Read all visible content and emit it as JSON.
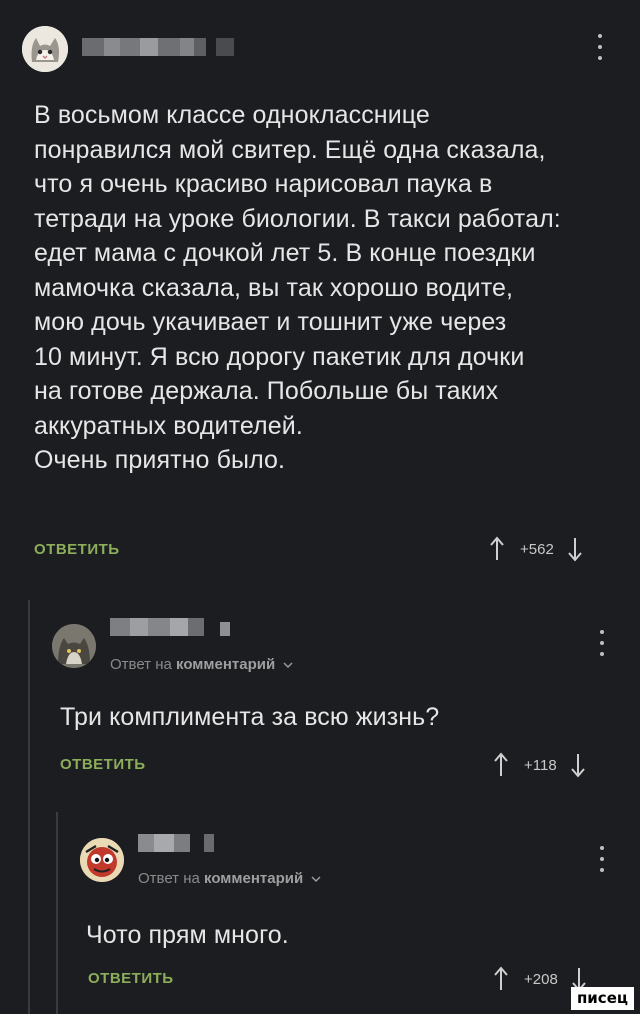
{
  "comments": [
    {
      "text_lines": [
        "В восьмом классе однокласснице",
        "понравился мой свитер. Ещё одна сказала,",
        "что я очень красиво нарисовал паука в",
        "тетради на уроке биологии. В такси работал:",
        "едет мама с дочкой лет 5. В конце поездки",
        "мамочка сказала, вы так хорошо водите,",
        "мою дочь укачивает и тошнит уже через",
        "10 минут. Я всю дорогу пакетик для дочки",
        "на готове держала. Побольше бы таких",
        "аккуратных водителей.",
        "Очень приятно было."
      ],
      "reply_label": "ОТВЕТИТЬ",
      "rating": "+562"
    },
    {
      "reply_to_prefix": "Ответ на",
      "reply_to_target": "комментарий",
      "text": "Три комплимента за всю жизнь?",
      "reply_label": "ОТВЕТИТЬ",
      "rating": "+118"
    },
    {
      "reply_to_prefix": "Ответ на",
      "reply_to_target": "комментарий",
      "text": "Чото прям много.",
      "reply_label": "ОТВЕТИТЬ",
      "rating": "+208"
    }
  ],
  "watermark": "писец",
  "colors": {
    "background": "#1c1d21",
    "accent_reply": "#8cae5b",
    "text": "#e6e6e6",
    "muted": "#8a8a8a"
  },
  "icons": [
    "cat-avatar",
    "cat-photo-avatar",
    "cartoon-avatar",
    "kebab-menu-icon",
    "arrow-up-icon",
    "arrow-down-icon",
    "chevron-down-icon"
  ]
}
